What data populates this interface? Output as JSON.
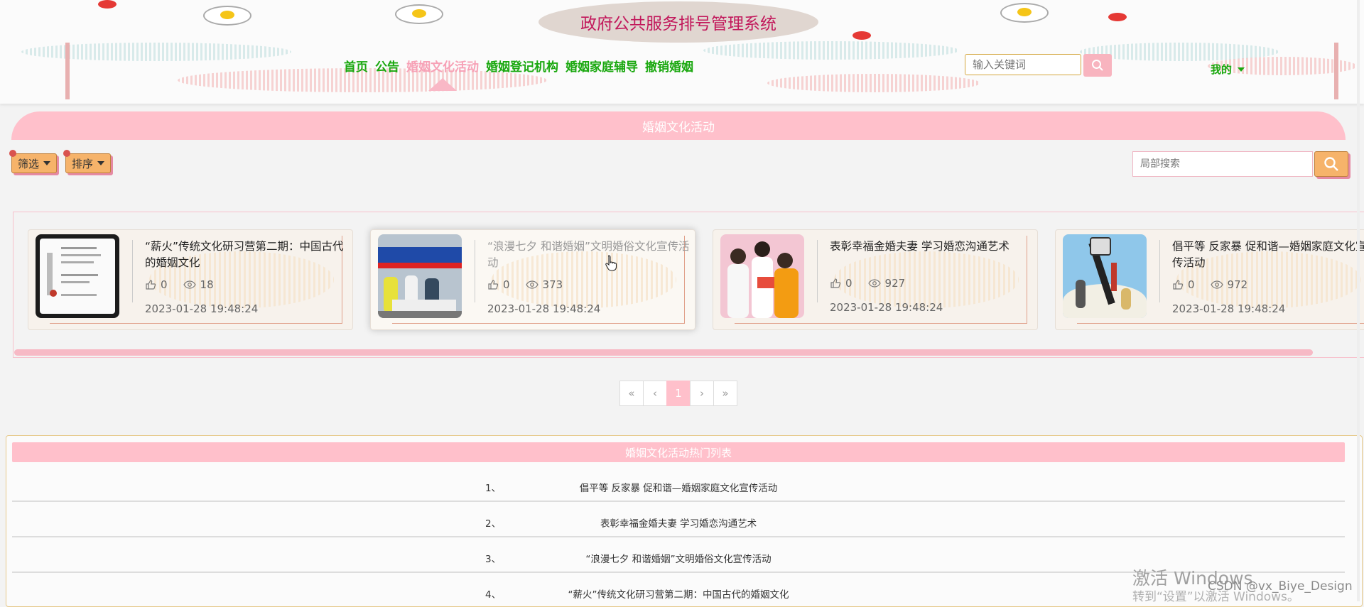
{
  "header": {
    "site_title": "政府公共服务排号管理系统",
    "nav": [
      {
        "label": "首页",
        "active": false
      },
      {
        "label": "公告",
        "active": false
      },
      {
        "label": "婚姻文化活动",
        "active": true
      },
      {
        "label": "婚姻登记机构",
        "active": false
      },
      {
        "label": "婚姻家庭辅导",
        "active": false
      },
      {
        "label": "撤销婚姻",
        "active": false
      }
    ],
    "search_placeholder": "输入关键词",
    "user_menu_label": "我的"
  },
  "section": {
    "title": "婚姻文化活动",
    "filter_label": "筛选",
    "sort_label": "排序",
    "local_search_placeholder": "局部搜索"
  },
  "cards": [
    {
      "title": "“薪火”传统文化研习营第二期：中国古代的婚姻文化",
      "likes": "0",
      "views": "18",
      "time": "2023-01-28 19:48:24",
      "image": "document-photo"
    },
    {
      "title": "“浪漫七夕 和谐婚姻”文明婚俗文化宣传活动",
      "likes": "0",
      "views": "373",
      "time": "2023-01-28 19:48:24",
      "image": "tent-event-photo"
    },
    {
      "title": "表彰幸福金婚夫妻 学习婚恋沟通艺术",
      "likes": "0",
      "views": "927",
      "time": "2023-01-28 19:48:24",
      "image": "people-photo"
    },
    {
      "title": "倡平等 反家暴 促和谐—婚姻家庭文化宣传活动",
      "likes": "0",
      "views": "972",
      "time": "2023-01-28 19:48:24",
      "image": "cartoon-illustration"
    }
  ],
  "pagination": {
    "first": "«",
    "prev": "‹",
    "current": "1",
    "next": "›",
    "last": "»"
  },
  "hot_list": {
    "title": "婚姻文化活动热门列表",
    "items": [
      {
        "num": "1、",
        "text": "倡平等 反家暴 促和谐—婚姻家庭文化宣传活动"
      },
      {
        "num": "2、",
        "text": "表彰幸福金婚夫妻 学习婚恋沟通艺术"
      },
      {
        "num": "3、",
        "text": "“浪漫七夕 和谐婚姻”文明婚俗文化宣传活动"
      },
      {
        "num": "4、",
        "text": "“薪火”传统文化研习营第二期：中国古代的婚姻文化"
      }
    ]
  },
  "overlay": {
    "activate_windows": "激活 Windows",
    "activate_hint": "转到“设置”以激活 Windows。",
    "csdn": "CSDN @vx_Biye_Design"
  },
  "colors": {
    "accent_pink": "#ffc0cb",
    "nav_green": "#1aa80f",
    "title_magenta": "#c2185b",
    "button_orange": "#f6b36a"
  }
}
